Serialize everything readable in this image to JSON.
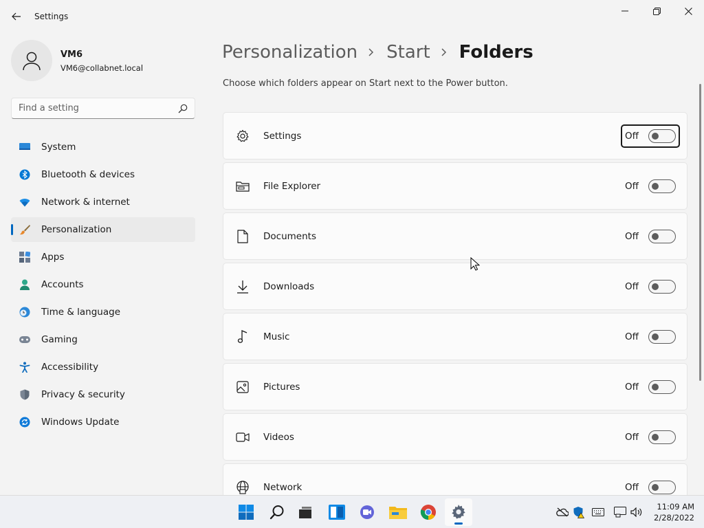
{
  "window": {
    "title": "Settings"
  },
  "user": {
    "name": "VM6",
    "email": "VM6@collabnet.local"
  },
  "search": {
    "placeholder": "Find a setting"
  },
  "nav": {
    "items": [
      {
        "label": "System",
        "icon": "monitor-icon"
      },
      {
        "label": "Bluetooth & devices",
        "icon": "bluetooth-icon"
      },
      {
        "label": "Network & internet",
        "icon": "wifi-icon"
      },
      {
        "label": "Personalization",
        "icon": "brush-icon",
        "active": true
      },
      {
        "label": "Apps",
        "icon": "apps-icon"
      },
      {
        "label": "Accounts",
        "icon": "person-icon"
      },
      {
        "label": "Time & language",
        "icon": "clock-globe-icon"
      },
      {
        "label": "Gaming",
        "icon": "gamepad-icon"
      },
      {
        "label": "Accessibility",
        "icon": "accessibility-icon"
      },
      {
        "label": "Privacy & security",
        "icon": "shield-icon"
      },
      {
        "label": "Windows Update",
        "icon": "update-icon"
      }
    ]
  },
  "breadcrumb": {
    "parts": [
      "Personalization",
      "Start",
      "Folders"
    ]
  },
  "page": {
    "description": "Choose which folders appear on Start next to the Power button."
  },
  "folders": [
    {
      "label": "Settings",
      "icon": "gear-icon",
      "state_label": "Off",
      "on": false,
      "focused": true
    },
    {
      "label": "File Explorer",
      "icon": "file-explorer-icon",
      "state_label": "Off",
      "on": false
    },
    {
      "label": "Documents",
      "icon": "document-icon",
      "state_label": "Off",
      "on": false
    },
    {
      "label": "Downloads",
      "icon": "download-icon",
      "state_label": "Off",
      "on": false
    },
    {
      "label": "Music",
      "icon": "music-note-icon",
      "state_label": "Off",
      "on": false
    },
    {
      "label": "Pictures",
      "icon": "picture-icon",
      "state_label": "Off",
      "on": false
    },
    {
      "label": "Videos",
      "icon": "video-icon",
      "state_label": "Off",
      "on": false
    },
    {
      "label": "Network",
      "icon": "network-globe-icon",
      "state_label": "Off",
      "on": false
    }
  ],
  "taskbar": {
    "apps": [
      "windows-start-icon",
      "search-icon",
      "task-view-icon",
      "widgets-icon",
      "chat-icon",
      "file-explorer-icon",
      "chrome-icon",
      "settings-gear-icon"
    ],
    "active_app": "settings-gear-icon",
    "tray": [
      "onedrive-icon",
      "defender-warning-icon",
      "keyboard-icon",
      "network-icon",
      "volume-icon"
    ],
    "time": "11:09 AM",
    "date": "2/28/2022"
  },
  "colors": {
    "accent": "#0067c0",
    "background": "#f3f3f3",
    "card": "#fbfbfb"
  }
}
